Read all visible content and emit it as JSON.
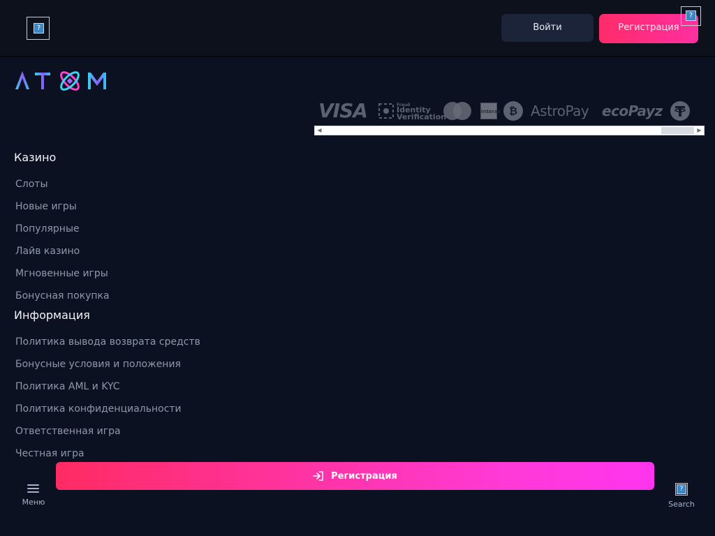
{
  "header": {
    "login_label": "Войти",
    "register_label": "Регистрация",
    "broken_image_glyph": "?"
  },
  "logo": {
    "text": "ATOM"
  },
  "payments": {
    "methods": [
      "VISA",
      "Identity Verification",
      "Mastercard",
      "Interac",
      "Bitcoin",
      "AstroPay",
      "ecoPayz",
      "Tether"
    ],
    "identity_line1": "Identity",
    "identity_line2": "Verification",
    "identity_small": "Fraud"
  },
  "casino": {
    "title": "Казино",
    "links": [
      "Слоты",
      "Новые игры",
      "Популярные",
      "Лайв казино",
      "Мгновенные игры",
      "Бонусная покупка"
    ]
  },
  "info": {
    "title": "Информация",
    "links": [
      "Политика вывода возврата средств",
      "Бонусные условия и положения",
      "Политика AML и KYC",
      "Политика конфиденциальности",
      "Ответственная игра",
      "Честная игра"
    ]
  },
  "bottom_bar": {
    "register_label": "Регистрация",
    "menu_label": "Меню",
    "search_label": "Search"
  },
  "colors": {
    "background": "#0b1120",
    "header": "#0c111c",
    "accent_pink": "#ff2b6a",
    "accent_magenta": "#ff35ef",
    "link": "#8e98ad"
  }
}
